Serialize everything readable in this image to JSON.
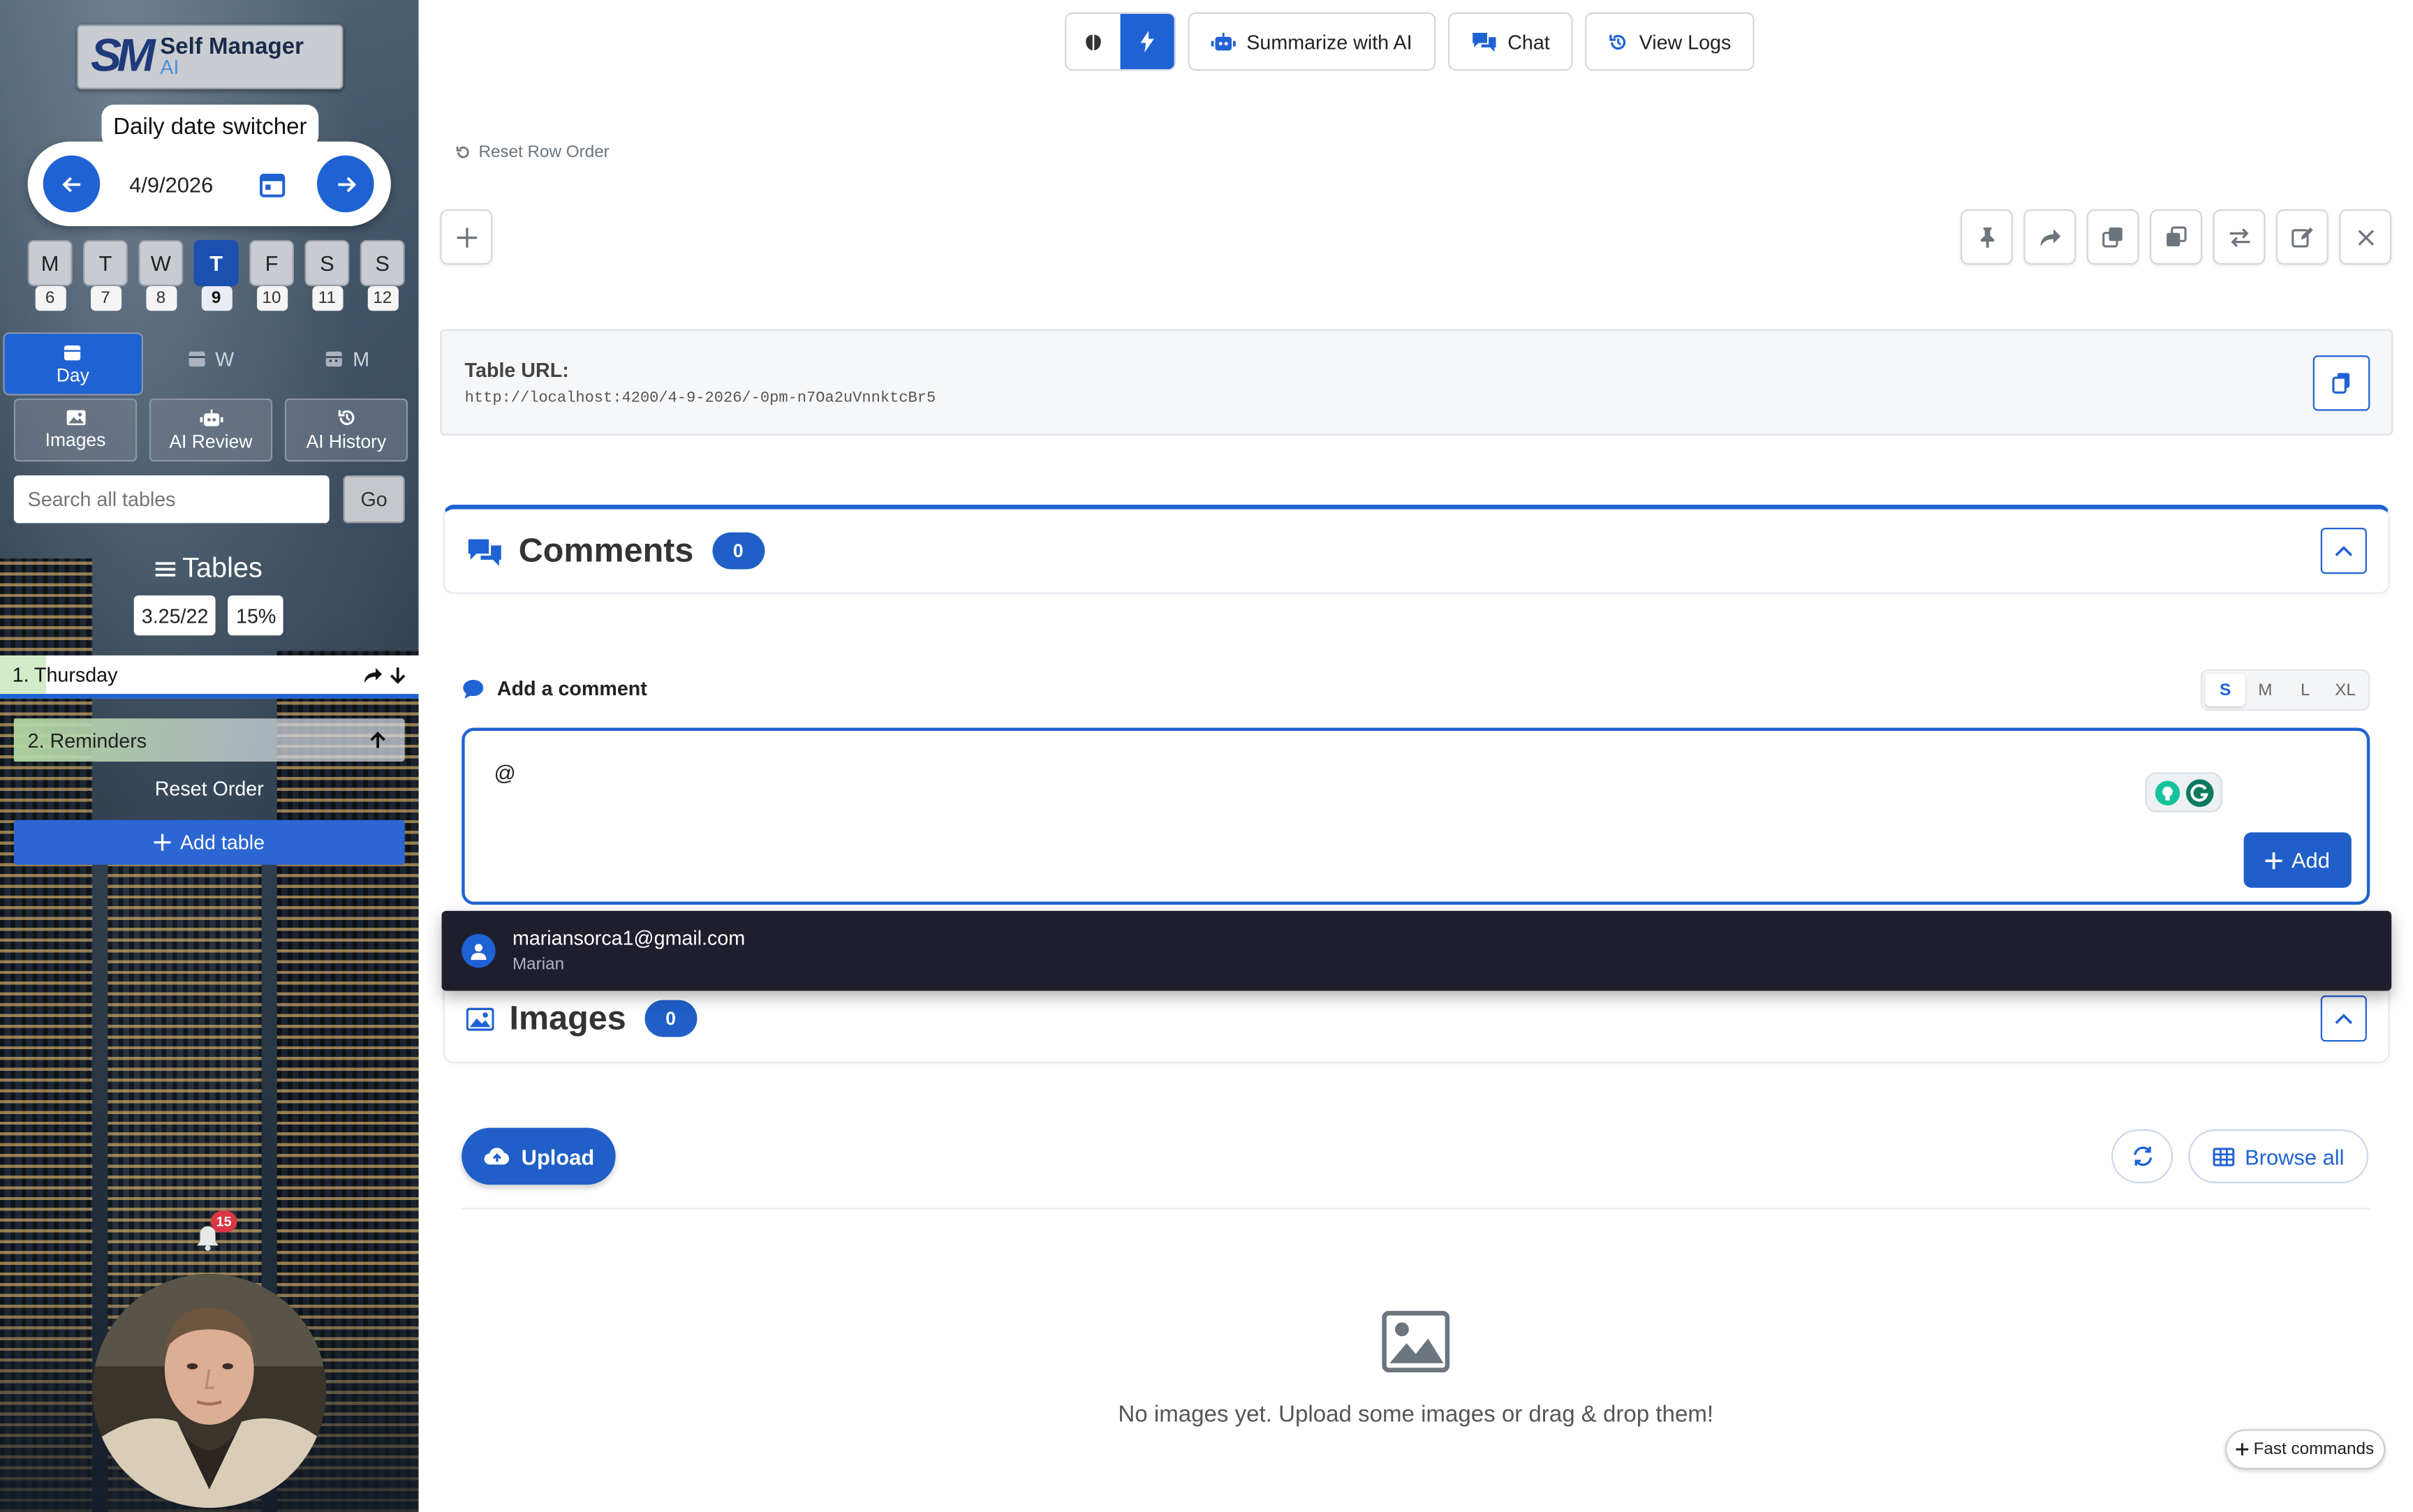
{
  "sidebar": {
    "logo": {
      "mark": "SM",
      "title": "Self Manager",
      "subtitle": "AI"
    },
    "date_switcher": {
      "label": "Daily date switcher",
      "date": "4/9/2026"
    },
    "week_days": [
      {
        "letter": "M",
        "num": "6"
      },
      {
        "letter": "T",
        "num": "7"
      },
      {
        "letter": "W",
        "num": "8"
      },
      {
        "letter": "T",
        "num": "9",
        "selected": true
      },
      {
        "letter": "F",
        "num": "10"
      },
      {
        "letter": "S",
        "num": "11"
      },
      {
        "letter": "S",
        "num": "12"
      }
    ],
    "view_tabs": {
      "day": "Day",
      "week": "W",
      "month": "M"
    },
    "actions": {
      "images": "Images",
      "ai_review": "AI Review",
      "ai_history": "AI History"
    },
    "search": {
      "placeholder": "Search all tables",
      "go": "Go"
    },
    "tables_heading": "Tables",
    "stats": {
      "ratio": "3.25/22",
      "percent": "15%"
    },
    "tables": [
      "1. Thursday",
      "2. Reminders"
    ],
    "reset_order": "Reset Order",
    "add_table": "Add table",
    "notifications": "15"
  },
  "toolbar": {
    "summarize": "Summarize with AI",
    "chat": "Chat",
    "view_logs": "View Logs"
  },
  "reset_row_order": "Reset Row Order",
  "table_url": {
    "label": "Table URL:",
    "value": "http://localhost:4200/4-9-2026/-0pm-n7Oa2uVnnktcBr5"
  },
  "comments": {
    "title": "Comments",
    "count": "0",
    "add_label": "Add a comment",
    "sizes": [
      "S",
      "M",
      "L",
      "XL"
    ],
    "input_value": "@",
    "add_button": "Add",
    "mention": {
      "email": "mariansorca1@gmail.com",
      "name": "Marian"
    }
  },
  "images": {
    "title": "Images",
    "count": "0",
    "upload": "Upload",
    "browse_all": "Browse all",
    "empty_text": "No images yet. Upload some images or drag & drop them!"
  },
  "fast_commands": "Fast commands",
  "colors": {
    "accent": "#1f62d3",
    "badge_red": "#dc3545",
    "dropdown_bg": "#1e1e2d"
  }
}
